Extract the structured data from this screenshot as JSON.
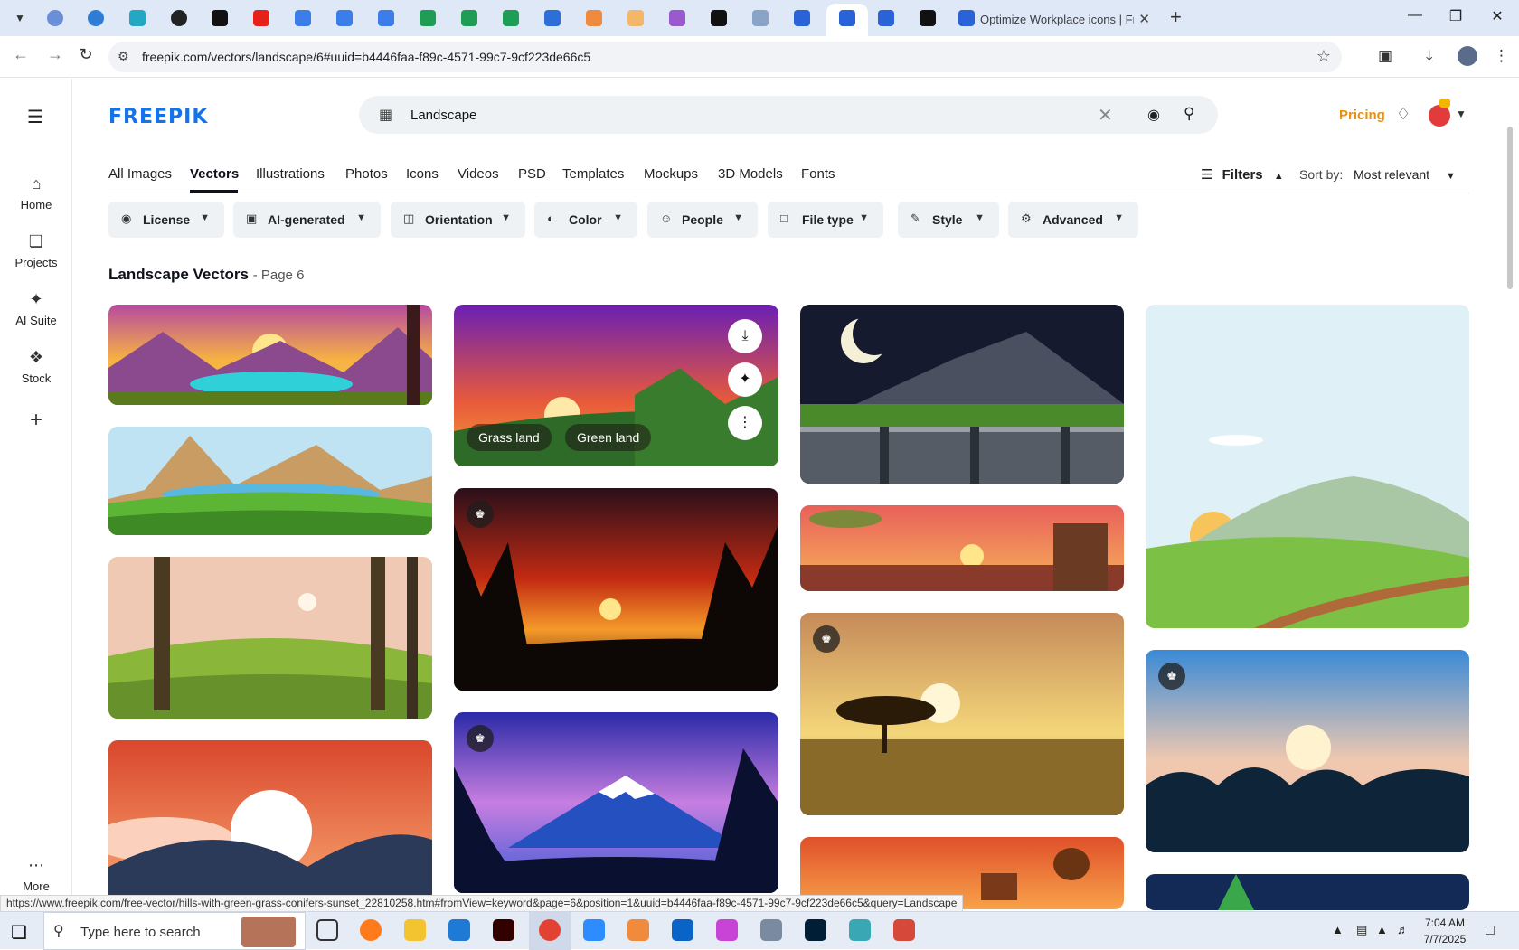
{
  "browser": {
    "active_tab_title": "Optimize Workplace icons | Fre",
    "url": "freepik.com/vectors/landscape/6#uuid=b4446faa-f89c-4571-99c7-9cf223de66c5",
    "status_url": "https://www.freepik.com/free-vector/hills-with-green-grass-conifers-sunset_22810258.htm#fromView=keyword&page=6&position=1&uuid=b4446faa-f89c-4571-99c7-9cf223de66c5&query=Landscape"
  },
  "sidebar": {
    "items": [
      {
        "label": "Home",
        "icon": "home-icon"
      },
      {
        "label": "Projects",
        "icon": "projects-icon"
      },
      {
        "label": "AI Suite",
        "icon": "sparkle-icon"
      },
      {
        "label": "Stock",
        "icon": "stock-icon"
      },
      {
        "label": "More",
        "icon": "more-icon"
      }
    ]
  },
  "header": {
    "logo": "FREEPIK",
    "search_value": "Landscape",
    "pricing_label": "Pricing"
  },
  "tabs": [
    "All Images",
    "Vectors",
    "Illustrations",
    "Photos",
    "Icons",
    "Videos",
    "PSD",
    "Templates",
    "Mockups",
    "3D Models",
    "Fonts"
  ],
  "active_tab": "Vectors",
  "filters_label": "Filters",
  "sort": {
    "label": "Sort by:",
    "value": "Most relevant"
  },
  "chips": [
    {
      "label": "License",
      "icon": "license-icon"
    },
    {
      "label": "AI-generated",
      "icon": "ai-icon"
    },
    {
      "label": "Orientation",
      "icon": "orientation-icon"
    },
    {
      "label": "Color",
      "icon": "palette-icon"
    },
    {
      "label": "People",
      "icon": "people-icon"
    },
    {
      "label": "File type",
      "icon": "file-icon"
    },
    {
      "label": "Style",
      "icon": "brush-icon"
    },
    {
      "label": "Advanced",
      "icon": "gear-icon"
    }
  ],
  "heading": {
    "title": "Landscape Vectors",
    "page": "- Page 6"
  },
  "hover_tags": [
    "Grass land",
    "Green land"
  ],
  "taskbar": {
    "search_placeholder": "Type here to search",
    "time": "7:04 AM",
    "date": "7/7/2025"
  },
  "colors": {
    "brand": "#1273eb",
    "pricing": "#e8900f"
  }
}
